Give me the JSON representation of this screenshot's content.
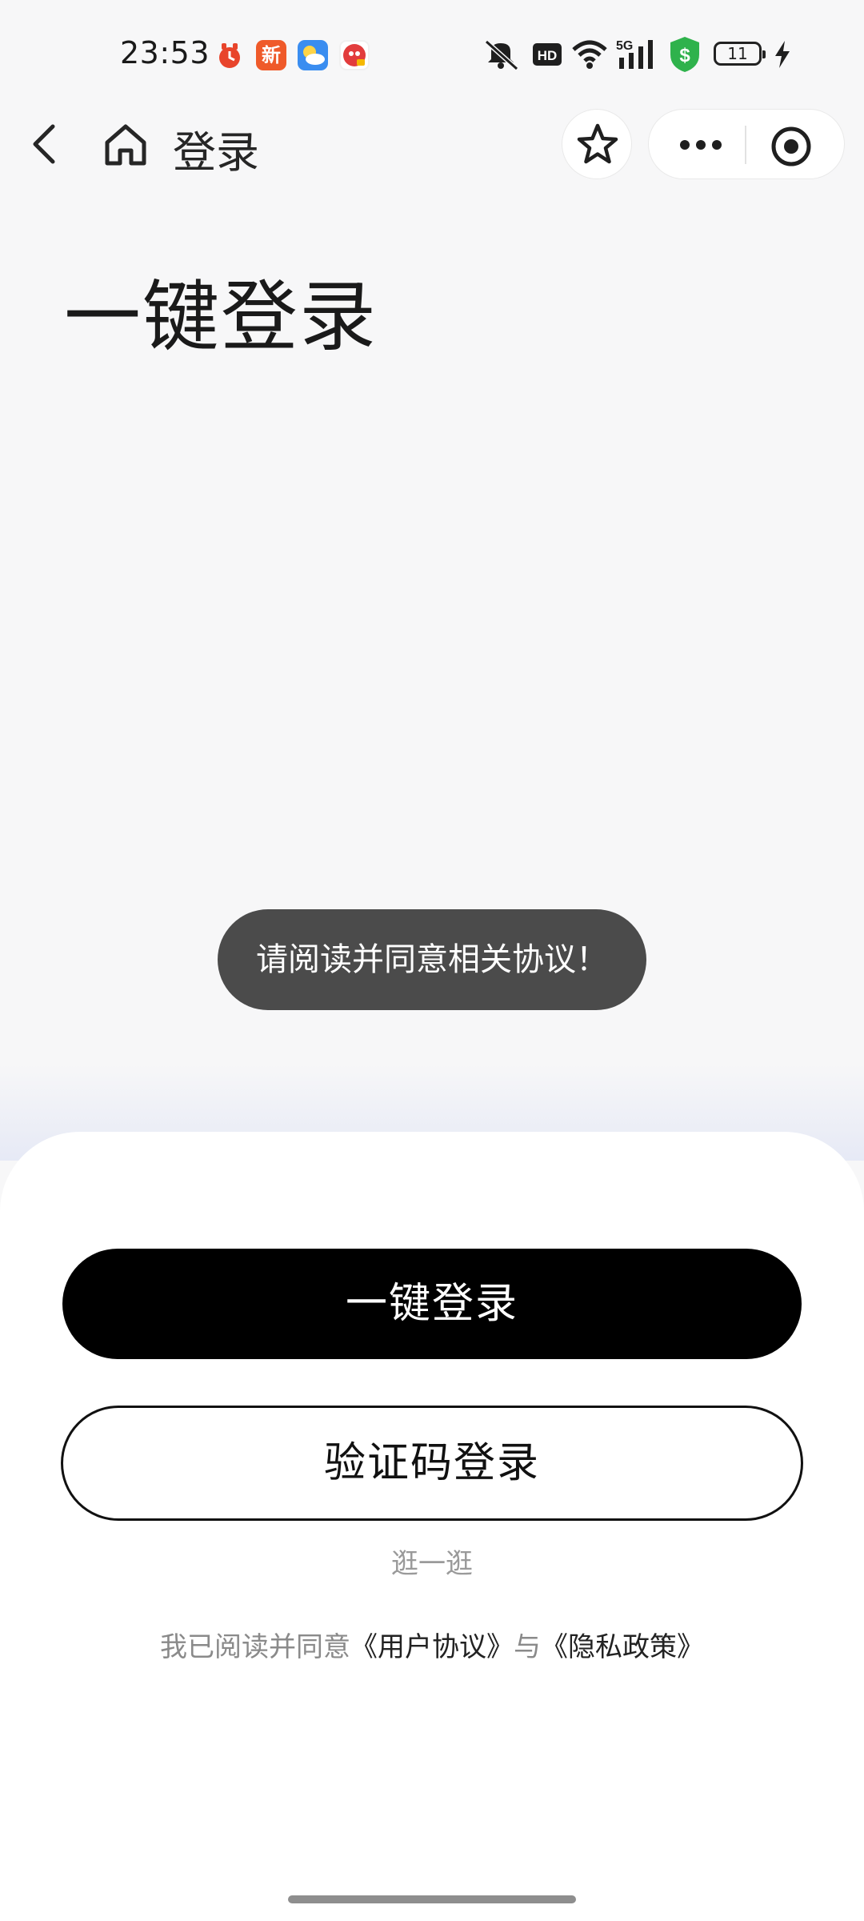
{
  "status_bar": {
    "time": "23:53",
    "notification_icons": [
      "alarm-clock-icon",
      "news-app-icon",
      "weather-app-icon",
      "game-app-icon"
    ],
    "news_badge_text": "新",
    "system_icons": [
      "mute-icon",
      "hd-icon",
      "wifi-icon",
      "5g-signal-icon",
      "security-shield-icon",
      "battery-icon",
      "charging-icon"
    ],
    "hd_label": "HD",
    "network_label": "5G",
    "battery_level": "11"
  },
  "nav": {
    "title": "登录",
    "icons": [
      "back-chevron-icon",
      "home-icon",
      "star-icon",
      "more-dots-icon",
      "target-icon"
    ]
  },
  "headline": "一键登录",
  "toast": "请阅读并同意相关协议！",
  "actions": {
    "primary_label": "一键登录",
    "secondary_label": "验证码登录",
    "browse_label": "逛一逛"
  },
  "agreement": {
    "prefix": "我已阅读并同意",
    "user_agreement": "《用户协议》",
    "connector": "与",
    "privacy_policy": "《隐私政策》"
  },
  "colors": {
    "background": "#f7f7f8",
    "primary_button": "#000000",
    "toast_background": "#4b4b4b",
    "security_green": "#2fb24c"
  }
}
